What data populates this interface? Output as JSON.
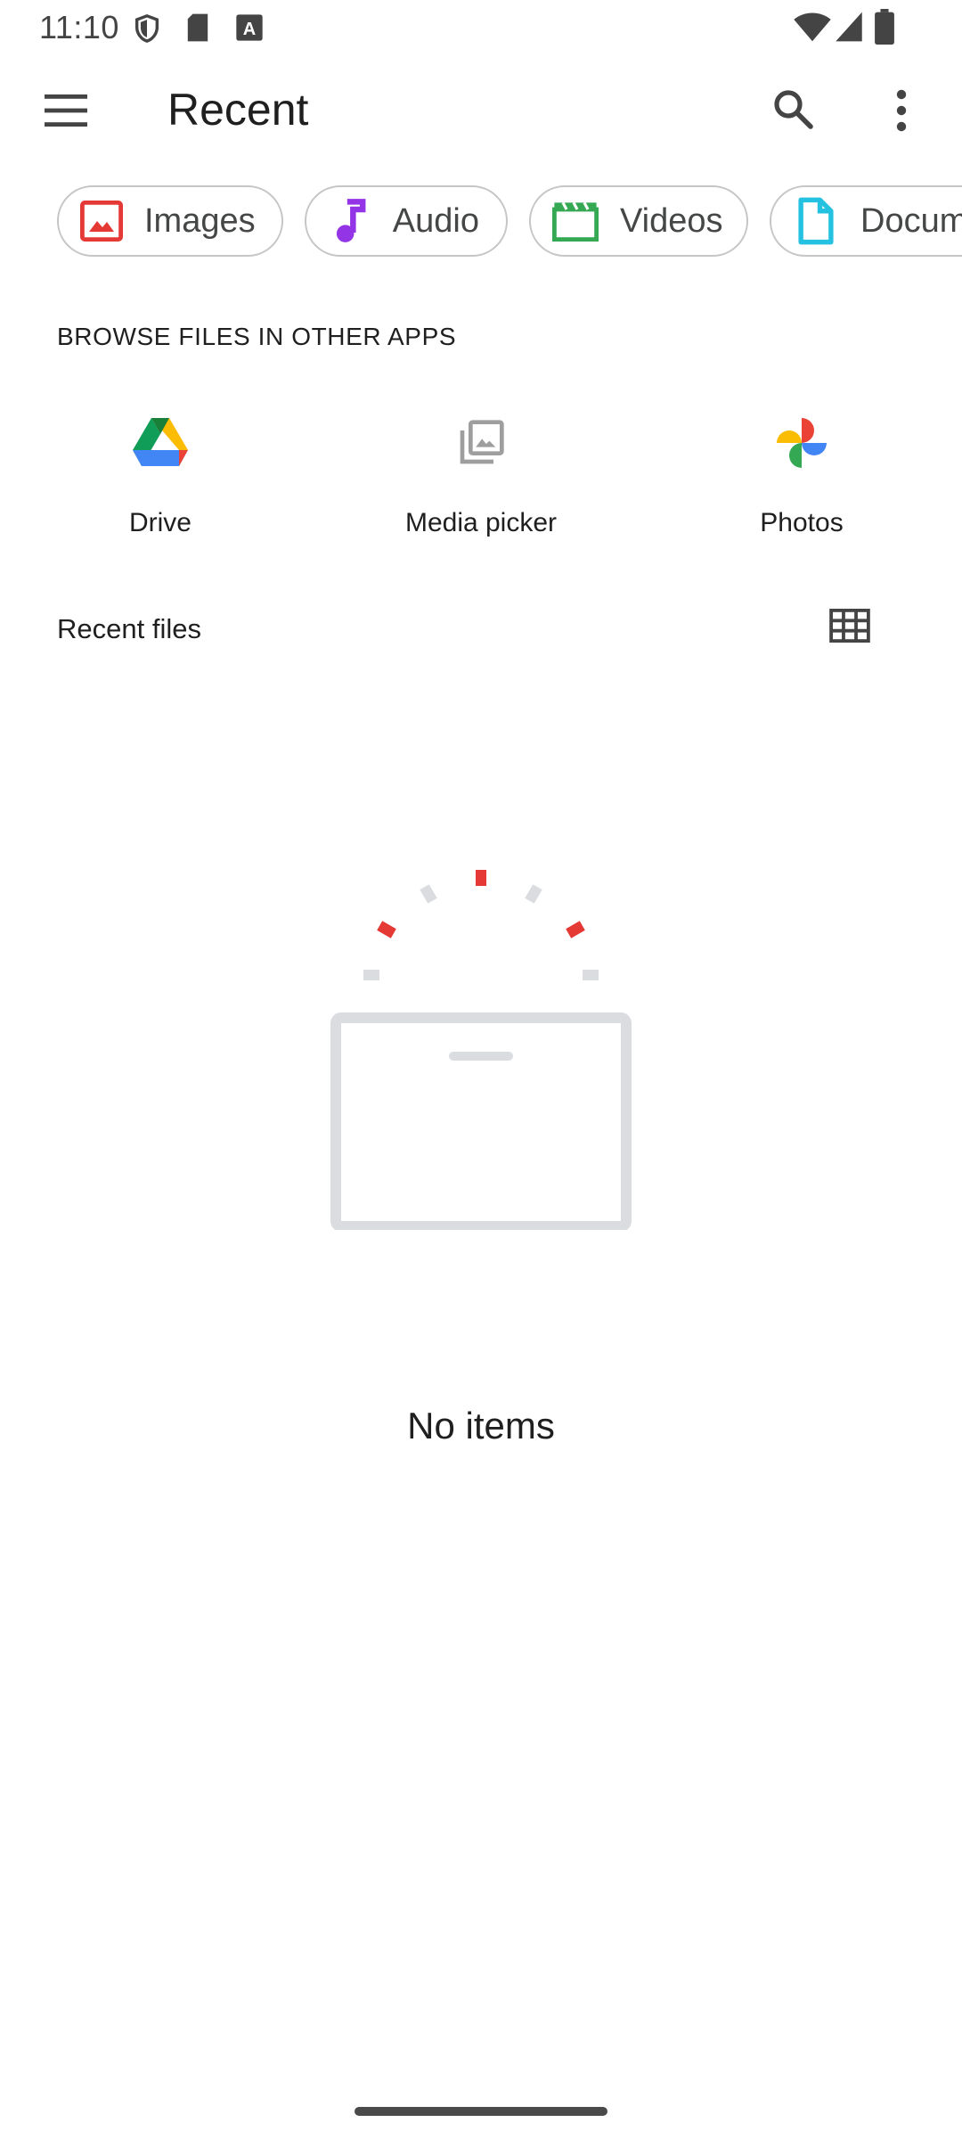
{
  "status_bar": {
    "time": "11:10",
    "icons": [
      "shield-icon",
      "sd-card-icon",
      "font-a-icon",
      "wifi-icon",
      "signal-icon",
      "battery-icon"
    ]
  },
  "app_bar": {
    "title": "Recent",
    "menu_icon": "hamburger-menu-icon",
    "search_icon": "search-icon",
    "more_icon": "more-vert-icon"
  },
  "chips": [
    {
      "label": "Images",
      "icon": "image-icon",
      "color": "#e53935"
    },
    {
      "label": "Audio",
      "icon": "music-note-icon",
      "color": "#9334e6"
    },
    {
      "label": "Videos",
      "icon": "movie-icon",
      "color": "#34a853"
    },
    {
      "label": "Docum",
      "icon": "document-icon",
      "color": "#24c1e0"
    }
  ],
  "browse_section": {
    "heading": "BROWSE FILES IN OTHER APPS",
    "apps": [
      {
        "label": "Drive",
        "icon": "google-drive-icon"
      },
      {
        "label": "Media picker",
        "icon": "photo-library-icon"
      },
      {
        "label": "Photos",
        "icon": "google-photos-icon"
      }
    ]
  },
  "recent_files": {
    "title": "Recent files",
    "view_toggle_icon": "grid-view-icon"
  },
  "empty_state": {
    "message": "No items"
  },
  "colors": {
    "accent_red": "#e53935",
    "illustration_gray": "#dadce0",
    "chip_border": "#c4c7c5"
  }
}
